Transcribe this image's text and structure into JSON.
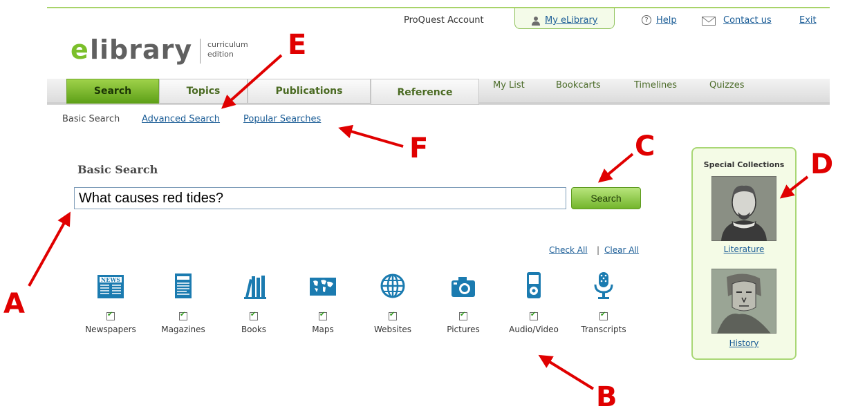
{
  "topnav": {
    "account": "ProQuest Account",
    "my_elibrary": "My eLibrary",
    "help": "Help",
    "contact": "Contact us",
    "exit": "Exit"
  },
  "logo": {
    "e": "e",
    "rest": "library",
    "sub1": "curriculum",
    "sub2": "edition"
  },
  "main_tabs": [
    "Search",
    "Topics",
    "Publications",
    "Reference"
  ],
  "sub_tabs": [
    "My List",
    "Bookcarts",
    "Timelines",
    "Quizzes"
  ],
  "subnav": {
    "basic": "Basic Search",
    "advanced": "Advanced Search",
    "popular": "Popular Searches"
  },
  "search": {
    "title": "Basic Search",
    "query": "What causes red tides?",
    "button": "Search"
  },
  "selection": {
    "check_all": "Check All",
    "sep": "|",
    "clear_all": "Clear All"
  },
  "content_types": [
    {
      "label": "Newspapers",
      "icon": "newspaper-icon",
      "checked": true
    },
    {
      "label": "Magazines",
      "icon": "magazine-icon",
      "checked": true
    },
    {
      "label": "Books",
      "icon": "books-icon",
      "checked": true
    },
    {
      "label": "Maps",
      "icon": "map-icon",
      "checked": true
    },
    {
      "label": "Websites",
      "icon": "globe-icon",
      "checked": true
    },
    {
      "label": "Pictures",
      "icon": "camera-icon",
      "checked": true
    },
    {
      "label": "Audio/Video",
      "icon": "media-player-icon",
      "checked": true
    },
    {
      "label": "Transcripts",
      "icon": "microphone-icon",
      "checked": true
    }
  ],
  "special_collections": {
    "title": "Special Collections",
    "items": [
      "Literature",
      "History"
    ]
  },
  "annotations": [
    "A",
    "B",
    "C",
    "D",
    "E",
    "F"
  ],
  "colors": {
    "brand_green": "#7bbf2a",
    "link_blue": "#1a5c96",
    "icon_blue": "#1b7bb0",
    "annotation_red": "#e00000"
  }
}
